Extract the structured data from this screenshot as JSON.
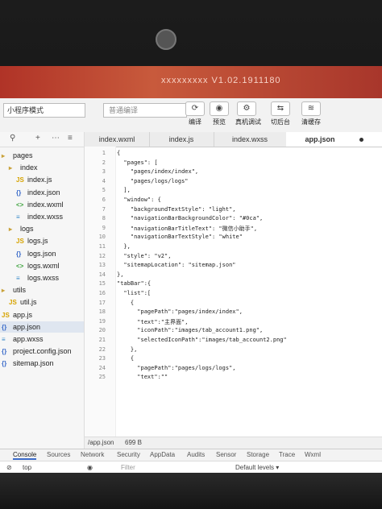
{
  "window": {
    "title": "xxxxxxxxx V1.02.1911180"
  },
  "toolbar": {
    "mode": "小程序模式",
    "compile_mode": "普通编译",
    "buttons": [
      {
        "icon": "refresh-icon",
        "glyph": "⟳",
        "label": "编译"
      },
      {
        "icon": "eye-icon",
        "glyph": "◉",
        "label": "预览"
      },
      {
        "icon": "debug-icon",
        "glyph": "⚙",
        "label": "真机调试"
      },
      {
        "icon": "backend-icon",
        "glyph": "⇆",
        "label": "切后台"
      },
      {
        "icon": "cache-icon",
        "glyph": "≋",
        "label": "清缓存"
      }
    ]
  },
  "sidebar": {
    "tree": [
      {
        "label": "pages",
        "type": "folder",
        "indent": 0
      },
      {
        "label": "index",
        "type": "folder",
        "indent": 1
      },
      {
        "label": "index.js",
        "type": "js",
        "indent": 2
      },
      {
        "label": "index.json",
        "type": "json",
        "indent": 2
      },
      {
        "label": "index.wxml",
        "type": "wxml",
        "indent": 2
      },
      {
        "label": "index.wxss",
        "type": "wxss",
        "indent": 2
      },
      {
        "label": "logs",
        "type": "folder",
        "indent": 1
      },
      {
        "label": "logs.js",
        "type": "js",
        "indent": 2
      },
      {
        "label": "logs.json",
        "type": "json",
        "indent": 2
      },
      {
        "label": "logs.wxml",
        "type": "wxml",
        "indent": 2
      },
      {
        "label": "logs.wxss",
        "type": "wxss",
        "indent": 2
      },
      {
        "label": "utils",
        "type": "folder",
        "indent": 0
      },
      {
        "label": "util.js",
        "type": "js",
        "indent": 1
      },
      {
        "label": "app.js",
        "type": "js",
        "indent": 0
      },
      {
        "label": "app.json",
        "type": "json",
        "indent": 0,
        "selected": true
      },
      {
        "label": "app.wxss",
        "type": "wxss",
        "indent": 0
      },
      {
        "label": "project.config.json",
        "type": "json",
        "indent": 0
      },
      {
        "label": "sitemap.json",
        "type": "json",
        "indent": 0
      }
    ]
  },
  "editor": {
    "tabs": [
      "index.wxml",
      "index.js",
      "index.wxss",
      "app.json"
    ],
    "active_tab": 3,
    "lines": [
      {
        "n": "1",
        "text": "{"
      },
      {
        "n": "2",
        "text": "  \"pages\": ["
      },
      {
        "n": "3",
        "text": "    \"pages/index/index\","
      },
      {
        "n": "4",
        "text": "    \"pages/logs/logs\""
      },
      {
        "n": "5",
        "text": "  ],"
      },
      {
        "n": "6",
        "text": "  \"window\": {"
      },
      {
        "n": "7",
        "text": "    \"backgroundTextStyle\": \"light\","
      },
      {
        "n": "8",
        "text": "    \"navigationBarBackgroundColor\": \"#0ca\","
      },
      {
        "n": "9",
        "text": "    \"navigationBarTitleText\": \"微信小助手\","
      },
      {
        "n": "10",
        "text": "    \"navigationBarTextStyle\": \"white\""
      },
      {
        "n": "11",
        "text": "  },"
      },
      {
        "n": "12",
        "text": "  \"style\": \"v2\","
      },
      {
        "n": "13",
        "text": "  \"sitemapLocation\": \"sitemap.json\""
      },
      {
        "n": "14",
        "text": "},"
      },
      {
        "n": "15",
        "text": "\"tabBar\":{"
      },
      {
        "n": "16",
        "text": "  \"list\":["
      },
      {
        "n": "17",
        "text": "    {"
      },
      {
        "n": "18",
        "text": "      \"pagePath\":\"pages/index/index\","
      },
      {
        "n": "19",
        "text": "      \"text\":\"主界面\","
      },
      {
        "n": "20",
        "text": "      \"iconPath\":\"images/tab_account1.png\","
      },
      {
        "n": "21",
        "text": "      \"selectedIconPath\":\"images/tab_account2.png\""
      },
      {
        "n": "22",
        "text": "    },"
      },
      {
        "n": "23",
        "text": "    {"
      },
      {
        "n": "24",
        "text": "      \"pagePath\":\"pages/logs/logs\","
      },
      {
        "n": "25",
        "text": "      \"text\":\"\""
      }
    ]
  },
  "status": {
    "file": "/app.json",
    "size": "699 B"
  },
  "console": {
    "tabs": [
      "Console",
      "Sources",
      "Network",
      "Security",
      "AppData",
      "Audits",
      "Sensor",
      "Storage",
      "Trace",
      "Wxml"
    ],
    "context": "top",
    "filter_placeholder": "Filter",
    "levels": "Default levels ▾"
  }
}
